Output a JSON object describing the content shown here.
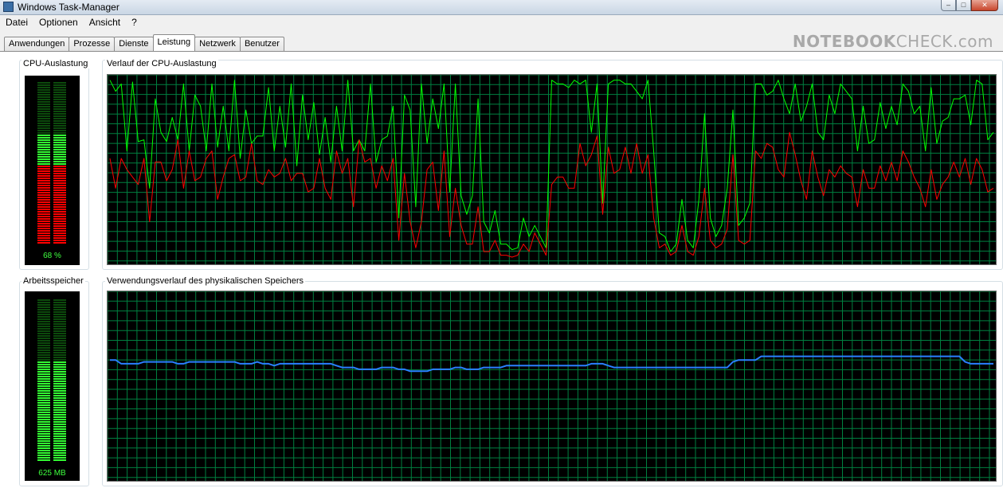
{
  "window": {
    "title": "Windows Task-Manager"
  },
  "titlebar_buttons": {
    "minimize": "–",
    "maximize": "□",
    "close": "✕"
  },
  "menu": [
    {
      "label": "Datei"
    },
    {
      "label": "Optionen"
    },
    {
      "label": "Ansicht"
    },
    {
      "label": "?"
    }
  ],
  "tabs": [
    {
      "label": "Anwendungen"
    },
    {
      "label": "Prozesse"
    },
    {
      "label": "Dienste"
    },
    {
      "label": "Leistung",
      "active": true
    },
    {
      "label": "Netzwerk"
    },
    {
      "label": "Benutzer"
    }
  ],
  "watermark": {
    "part1": "NOTEBOOK",
    "part2": "CHECK.com"
  },
  "cpu_meter": {
    "title": "CPU-Auslastung",
    "value_text": "68 %",
    "usage_fraction": 0.68,
    "kernel_fraction": 0.48
  },
  "cpu_history": {
    "title": "Verlauf der CPU-Auslastung"
  },
  "mem_meter": {
    "title": "Arbeitsspeicher",
    "value_text": "625 MB",
    "usage_fraction": 0.62
  },
  "mem_history": {
    "title": "Verwendungsverlauf des physikalischen Speichers"
  },
  "colors": {
    "grid": "#008040",
    "cpu_total": "#00ff00",
    "cpu_kernel": "#ff0000",
    "memory": "#2a7fff",
    "meter_bg": "#000000"
  },
  "chart_data": [
    {
      "type": "line",
      "title": "Verlauf der CPU-Auslastung",
      "ylim": [
        0,
        100
      ],
      "grid": true,
      "series": [
        {
          "values": [
            98,
            92,
            96,
            60,
            97,
            65,
            66,
            40,
            88,
            70,
            65,
            78,
            66,
            96,
            60,
            90,
            84,
            60,
            96,
            62,
            84,
            60,
            98,
            56,
            82,
            64,
            68,
            68,
            94,
            60,
            84,
            62,
            96,
            52,
            90,
            66,
            86,
            58,
            78,
            54,
            84,
            60,
            98,
            60,
            66,
            60,
            96,
            54,
            66,
            68,
            84,
            24,
            90,
            82,
            30,
            96,
            64,
            88,
            72,
            96,
            38,
            96,
            36,
            26,
            36,
            88,
            22,
            16,
            28,
            10,
            10,
            7,
            8,
            24,
            14,
            20,
            14,
            8,
            98,
            96,
            96,
            94,
            98,
            96,
            98,
            70,
            96,
            32,
            96,
            98,
            98,
            96,
            96,
            92,
            88,
            98,
            60,
            16,
            14,
            6,
            10,
            34,
            12,
            8,
            34,
            80,
            24,
            14,
            20,
            40,
            82,
            20,
            24,
            32,
            96,
            96,
            90,
            92,
            98,
            88,
            80,
            96,
            76,
            84,
            96,
            70,
            66,
            90,
            80,
            96,
            92,
            88,
            60,
            84,
            64,
            66,
            86,
            72,
            84,
            74,
            96,
            92,
            80,
            84,
            60,
            94,
            64,
            76,
            78,
            88,
            88,
            90,
            74,
            98,
            96,
            66,
            70
          ]
        },
        {
          "values": [
            56,
            40,
            56,
            50,
            46,
            42,
            56,
            22,
            54,
            54,
            44,
            50,
            66,
            40,
            60,
            44,
            46,
            56,
            60,
            34,
            46,
            56,
            58,
            44,
            46,
            64,
            44,
            42,
            50,
            46,
            48,
            56,
            44,
            48,
            48,
            38,
            40,
            56,
            40,
            34,
            60,
            48,
            56,
            30,
            66,
            54,
            56,
            40,
            52,
            44,
            56,
            12,
            48,
            22,
            8,
            22,
            50,
            54,
            28,
            60,
            14,
            40,
            20,
            10,
            10,
            30,
            6,
            6,
            12,
            4,
            4,
            3,
            4,
            10,
            6,
            16,
            10,
            4,
            42,
            46,
            46,
            40,
            40,
            64,
            52,
            58,
            68,
            26,
            62,
            48,
            50,
            62,
            48,
            64,
            48,
            58,
            24,
            8,
            10,
            4,
            6,
            20,
            6,
            4,
            14,
            40,
            12,
            8,
            10,
            18,
            58,
            12,
            10,
            12,
            60,
            56,
            64,
            62,
            50,
            46,
            70,
            58,
            44,
            34,
            60,
            46,
            36,
            50,
            46,
            52,
            48,
            46,
            30,
            50,
            40,
            40,
            52,
            44,
            54,
            44,
            60,
            54,
            46,
            40,
            30,
            50,
            34,
            42,
            46,
            54,
            46,
            56,
            42,
            56,
            50,
            38,
            40
          ]
        }
      ]
    },
    {
      "type": "line",
      "title": "Verwendungsverlauf des physikalischen Speichers",
      "ylim": [
        0,
        100
      ],
      "grid": true,
      "series": [
        {
          "values": [
            64,
            64,
            62,
            62,
            62,
            62,
            63,
            63,
            63,
            63,
            63,
            63,
            62,
            62,
            63,
            63,
            63,
            63,
            63,
            63,
            63,
            63,
            63,
            62,
            62,
            62,
            63,
            62,
            62,
            61,
            62,
            62,
            62,
            62,
            62,
            62,
            62,
            62,
            62,
            62,
            61,
            60,
            60,
            60,
            59,
            59,
            59,
            59,
            60,
            60,
            60,
            59,
            59,
            58,
            58,
            58,
            58,
            59,
            59,
            59,
            59,
            60,
            60,
            59,
            59,
            59,
            60,
            60,
            60,
            60,
            61,
            61,
            61,
            61,
            61,
            61,
            61,
            61,
            61,
            61,
            61,
            61,
            61,
            61,
            61,
            62,
            62,
            62,
            61,
            60,
            60,
            60,
            60,
            60,
            60,
            60,
            60,
            60,
            60,
            60,
            60,
            60,
            60,
            60,
            60,
            60,
            60,
            60,
            60,
            60,
            63,
            64,
            64,
            64,
            64,
            66,
            66,
            66,
            66,
            66,
            66,
            66,
            66,
            66,
            66,
            66,
            66,
            66,
            66,
            66,
            66,
            66,
            66,
            66,
            66,
            66,
            66,
            66,
            66,
            66,
            66,
            66,
            66,
            66,
            66,
            66,
            66,
            66,
            66,
            66,
            66,
            63,
            62,
            62,
            62,
            62,
            62
          ]
        }
      ]
    }
  ]
}
